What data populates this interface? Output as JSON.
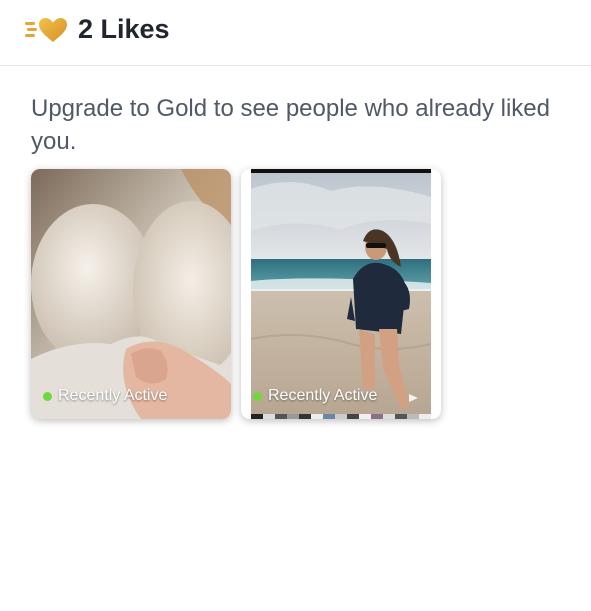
{
  "header": {
    "title": "2 Likes",
    "icon": "likes-heart-icon"
  },
  "main": {
    "upgrade_text": "Upgrade to Gold to see people who already liked you."
  },
  "cards": [
    {
      "status": "Recently Active",
      "status_color": "#6fd83b"
    },
    {
      "status": "Recently Active",
      "status_color": "#6fd83b"
    }
  ],
  "colors": {
    "gold": "#e3a63b",
    "title": "#21262e",
    "text": "#505965"
  }
}
